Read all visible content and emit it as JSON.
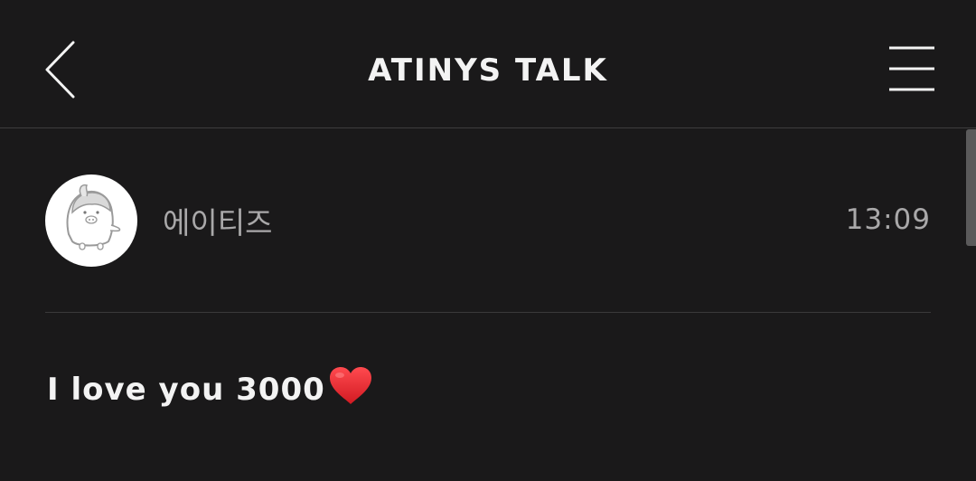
{
  "header": {
    "title": "ATINYS TALK",
    "back_icon": "chevron-left-icon",
    "menu_icon": "hamburger-menu-icon"
  },
  "post": {
    "author_name": "에이티즈",
    "time": "13:09",
    "avatar_icon": "penguin-avatar-icon",
    "message_text": "I love you 3000",
    "message_emoji": "red-heart-icon"
  },
  "colors": {
    "background": "#1a191a",
    "primary_text": "#f3f3f3",
    "secondary_text": "#a9a8a9",
    "heart": "#e5262c"
  }
}
